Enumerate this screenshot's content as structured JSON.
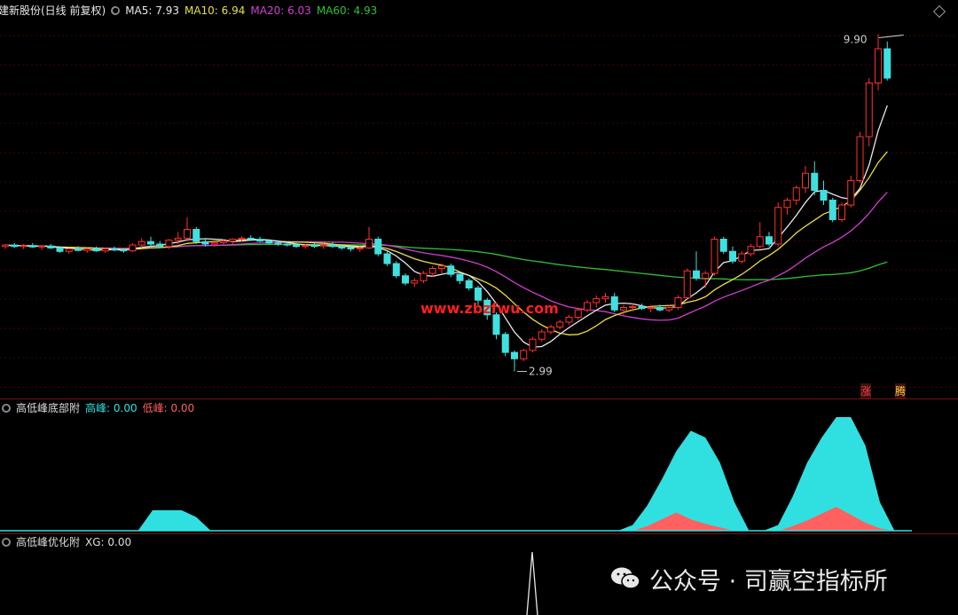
{
  "main_header": {
    "title": "建新股份(日线 前复权)",
    "ma": [
      {
        "label": "MA5: 7.93",
        "color": "#e8e8e8"
      },
      {
        "label": "MA10: 6.94",
        "color": "#e8e040"
      },
      {
        "label": "MA20: 6.03",
        "color": "#d040d0"
      },
      {
        "label": "MA60: 4.93",
        "color": "#30c030"
      }
    ]
  },
  "indicator1_header": {
    "title": "高低峰底部附",
    "items": [
      {
        "label": "高峰: 0.00",
        "color": "#30e0e0"
      },
      {
        "label": "低峰: 0.00",
        "color": "#ff6060"
      }
    ]
  },
  "indicator2_header": {
    "title": "高低峰优化附",
    "items": [
      {
        "label": "XG: 0.00",
        "color": "#dddddd"
      }
    ]
  },
  "watermark": "www.zbzfwu.com",
  "brand": {
    "text": "公众号 · 司赢空指标所",
    "icon": "wechat-icon"
  },
  "signal_tags": {
    "zhang": "涨",
    "teng": "腾"
  },
  "colors": {
    "up": "#ff3030",
    "down": "#40e0e0",
    "ma5": "#e8e8e8",
    "ma10": "#e8e040",
    "ma20": "#d040d0",
    "ma60": "#30c030",
    "peak_high": "#30e0e0",
    "peak_low": "#ff6060"
  },
  "chart_data": {
    "type": "candlestick",
    "price_range": [
      2.6,
      10.2
    ],
    "annotations": {
      "high_label": "9.90",
      "low_label": "2.99",
      "high_value": 9.9,
      "low_value": 2.99
    },
    "candles": [
      [
        5.55,
        5.6,
        5.5,
        5.58
      ],
      [
        5.58,
        5.62,
        5.52,
        5.55
      ],
      [
        5.55,
        5.6,
        5.5,
        5.57
      ],
      [
        5.57,
        5.62,
        5.52,
        5.54
      ],
      [
        5.54,
        5.58,
        5.48,
        5.56
      ],
      [
        5.56,
        5.6,
        5.5,
        5.52
      ],
      [
        5.52,
        5.56,
        5.42,
        5.45
      ],
      [
        5.45,
        5.52,
        5.4,
        5.5
      ],
      [
        5.5,
        5.56,
        5.45,
        5.47
      ],
      [
        5.47,
        5.52,
        5.42,
        5.5
      ],
      [
        5.5,
        5.55,
        5.44,
        5.46
      ],
      [
        5.46,
        5.52,
        5.42,
        5.5
      ],
      [
        5.5,
        5.55,
        5.45,
        5.48
      ],
      [
        5.48,
        5.52,
        5.42,
        5.46
      ],
      [
        5.46,
        5.62,
        5.44,
        5.58
      ],
      [
        5.58,
        5.72,
        5.52,
        5.65
      ],
      [
        5.65,
        5.75,
        5.55,
        5.6
      ],
      [
        5.6,
        5.66,
        5.52,
        5.55
      ],
      [
        5.55,
        5.7,
        5.5,
        5.68
      ],
      [
        5.68,
        5.85,
        5.6,
        5.72
      ],
      [
        5.72,
        6.15,
        5.65,
        5.9
      ],
      [
        5.9,
        5.95,
        5.6,
        5.65
      ],
      [
        5.65,
        5.72,
        5.55,
        5.6
      ],
      [
        5.6,
        5.66,
        5.55,
        5.63
      ],
      [
        5.63,
        5.7,
        5.58,
        5.66
      ],
      [
        5.66,
        5.72,
        5.6,
        5.7
      ],
      [
        5.7,
        5.76,
        5.64,
        5.72
      ],
      [
        5.72,
        5.78,
        5.66,
        5.7
      ],
      [
        5.7,
        5.75,
        5.64,
        5.66
      ],
      [
        5.66,
        5.7,
        5.6,
        5.62
      ],
      [
        5.62,
        5.68,
        5.56,
        5.6
      ],
      [
        5.6,
        5.64,
        5.55,
        5.58
      ],
      [
        5.58,
        5.62,
        5.52,
        5.55
      ],
      [
        5.55,
        5.6,
        5.5,
        5.57
      ],
      [
        5.57,
        5.62,
        5.52,
        5.56
      ],
      [
        5.56,
        5.62,
        5.5,
        5.58
      ],
      [
        5.58,
        5.64,
        5.52,
        5.55
      ],
      [
        5.55,
        5.6,
        5.48,
        5.52
      ],
      [
        5.52,
        5.56,
        5.45,
        5.5
      ],
      [
        5.5,
        5.55,
        5.44,
        5.52
      ],
      [
        5.52,
        5.95,
        5.5,
        5.7
      ],
      [
        5.7,
        5.75,
        5.35,
        5.4
      ],
      [
        5.4,
        5.45,
        5.15,
        5.2
      ],
      [
        5.2,
        5.25,
        4.9,
        4.95
      ],
      [
        4.95,
        5.0,
        4.75,
        4.8
      ],
      [
        4.8,
        4.9,
        4.72,
        4.85
      ],
      [
        4.85,
        5.05,
        4.8,
        5.0
      ],
      [
        5.0,
        5.15,
        4.92,
        5.1
      ],
      [
        5.1,
        5.2,
        5.0,
        5.15
      ],
      [
        5.15,
        5.2,
        4.92,
        4.98
      ],
      [
        4.98,
        5.02,
        4.78,
        4.85
      ],
      [
        4.85,
        4.9,
        4.65,
        4.7
      ],
      [
        4.7,
        4.75,
        4.35,
        4.45
      ],
      [
        4.45,
        4.5,
        4.05,
        4.15
      ],
      [
        4.15,
        4.2,
        3.65,
        3.75
      ],
      [
        3.75,
        3.8,
        3.3,
        3.38
      ],
      [
        3.38,
        3.42,
        2.99,
        3.25
      ],
      [
        3.25,
        3.45,
        3.2,
        3.42
      ],
      [
        3.42,
        3.7,
        3.38,
        3.65
      ],
      [
        3.65,
        3.85,
        3.6,
        3.8
      ],
      [
        3.8,
        3.95,
        3.75,
        3.9
      ],
      [
        3.9,
        4.05,
        3.85,
        4.0
      ],
      [
        4.0,
        4.15,
        3.95,
        4.1
      ],
      [
        4.1,
        4.3,
        4.05,
        4.25
      ],
      [
        4.25,
        4.45,
        4.2,
        4.4
      ],
      [
        4.4,
        4.55,
        4.3,
        4.48
      ],
      [
        4.48,
        4.6,
        4.4,
        4.52
      ],
      [
        4.52,
        4.6,
        4.2,
        4.25
      ],
      [
        4.25,
        4.35,
        4.15,
        4.3
      ],
      [
        4.3,
        4.38,
        4.22,
        4.32
      ],
      [
        4.32,
        4.38,
        4.25,
        4.28
      ],
      [
        4.28,
        4.35,
        4.2,
        4.3
      ],
      [
        4.3,
        4.36,
        4.22,
        4.25
      ],
      [
        4.25,
        4.35,
        4.2,
        4.3
      ],
      [
        4.3,
        4.55,
        4.25,
        4.5
      ],
      [
        4.5,
        5.1,
        4.45,
        5.05
      ],
      [
        5.05,
        5.45,
        4.85,
        4.9
      ],
      [
        4.9,
        5.05,
        4.7,
        5.0
      ],
      [
        5.0,
        5.75,
        4.95,
        5.7
      ],
      [
        5.7,
        5.75,
        5.4,
        5.45
      ],
      [
        5.45,
        5.55,
        5.2,
        5.25
      ],
      [
        5.25,
        5.45,
        5.2,
        5.4
      ],
      [
        5.4,
        5.6,
        5.35,
        5.55
      ],
      [
        5.55,
        6.05,
        5.5,
        5.75
      ],
      [
        5.75,
        5.85,
        5.55,
        5.6
      ],
      [
        5.6,
        6.45,
        5.55,
        6.35
      ],
      [
        6.35,
        6.55,
        6.2,
        6.5
      ],
      [
        6.5,
        6.8,
        6.4,
        6.75
      ],
      [
        6.75,
        7.2,
        6.65,
        7.05
      ],
      [
        7.05,
        7.3,
        6.6,
        6.7
      ],
      [
        6.7,
        6.9,
        6.4,
        6.5
      ],
      [
        6.5,
        6.55,
        6.05,
        6.1
      ],
      [
        6.1,
        6.45,
        6.05,
        6.4
      ],
      [
        6.4,
        7.0,
        6.35,
        6.9
      ],
      [
        6.9,
        7.9,
        6.85,
        7.8
      ],
      [
        7.8,
        9.0,
        7.6,
        8.9
      ],
      [
        8.9,
        9.9,
        8.75,
        9.6
      ],
      [
        9.6,
        9.75,
        8.95,
        9.0
      ]
    ],
    "peaks_low_area": {
      "high_peak": [
        0,
        0,
        0,
        0,
        0,
        0,
        0,
        0,
        0,
        0,
        0.18,
        0.18,
        0.18,
        0.12,
        0,
        0,
        0,
        0,
        0,
        0,
        0,
        0,
        0,
        0,
        0,
        0,
        0,
        0,
        0,
        0,
        0,
        0,
        0,
        0,
        0,
        0,
        0,
        0,
        0,
        0,
        0,
        0,
        0,
        0.05,
        0.22,
        0.45,
        0.7,
        0.88,
        0.82,
        0.6,
        0.25,
        0,
        0,
        0.05,
        0.3,
        0.6,
        0.82,
        1.0,
        1.0,
        0.75,
        0.25,
        0,
        0
      ],
      "low_peak": [
        0,
        0,
        0,
        0,
        0,
        0,
        0,
        0,
        0,
        0,
        0,
        0,
        0,
        0,
        0,
        0,
        0,
        0,
        0,
        0,
        0,
        0,
        0,
        0,
        0,
        0,
        0,
        0,
        0,
        0,
        0,
        0,
        0,
        0,
        0,
        0,
        0,
        0,
        0,
        0,
        0,
        0,
        0,
        0,
        0.04,
        0.1,
        0.16,
        0.1,
        0.06,
        0.03,
        0,
        0,
        0,
        0,
        0.04,
        0.09,
        0.15,
        0.21,
        0.14,
        0.07,
        0.02,
        0,
        0
      ]
    }
  }
}
